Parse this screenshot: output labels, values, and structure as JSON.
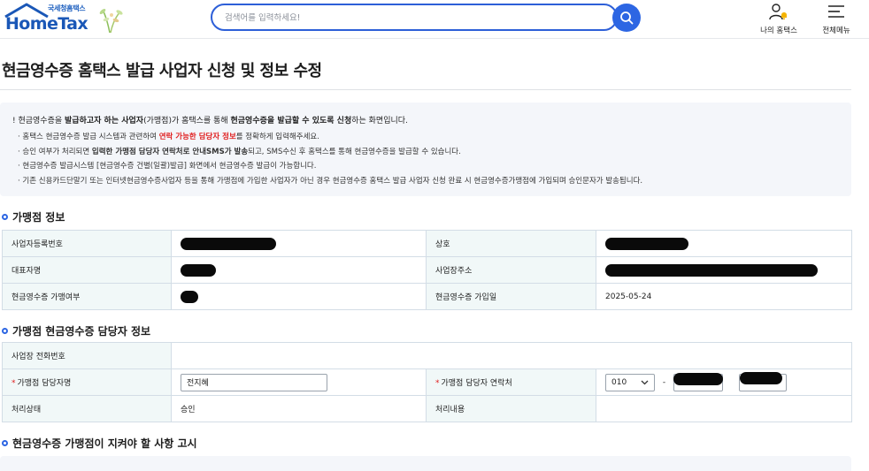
{
  "header": {
    "logo_sub": "국세청홈택스",
    "logo_main": "HomeTax",
    "search_placeholder": "검색어를 입력하세요!",
    "my_hometax": "나의 홈택스",
    "all_menu": "전체메뉴"
  },
  "page": {
    "title": "현금영수증 홈택스 발급 사업자 신청 및 정보 수정"
  },
  "notice": {
    "main": [
      "현금영수증을 ",
      "발급하고자 하는 사업자",
      "(가맹점)가 홈택스를 통해 ",
      "현금영수증을 발급할 수 있도록 신청",
      "하는 화면입니다."
    ],
    "items": [
      [
        "홈택스 현금영수증 발급 시스템과 관련하여 ",
        "연락 가능한 담당자 정보",
        "를 정확하게 입력해주세요."
      ],
      [
        "승인 여부가 처리되면 ",
        "입력한 가맹점 담당자 연락처로 안내SMS가 발송",
        "되고, SMS수신 후 홈택스를 통해 현금영수증을 발급할 수 있습니다."
      ],
      [
        "현금영수증 발급시스템 [현금영수증 건별(일괄)발급] 화면에서 현금영수증 발급이 가능합니다."
      ],
      [
        "기존 신용카드단말기 또는 인터넷현금영수증사업자 등을 통해 가맹점에 가입한 사업자가 아닌 경우 현금영수증 홈택스 발급 사업자 신청 완료 시 현금영수증가맹점에 가입되며 승인문자가 발송됩니다."
      ]
    ]
  },
  "merchant_info": {
    "title": "가맹점 정보",
    "labels": {
      "biz_no": "사업자등록번호",
      "trade_name": "상호",
      "ceo": "대표자명",
      "address": "사업장주소",
      "joined": "현금영수증 가맹여부",
      "join_date": "현금영수증 가입일"
    },
    "values": {
      "join_date": "2025-05-24"
    }
  },
  "contact_info": {
    "title": "가맹점 현금영수증 담당자 정보",
    "labels": {
      "phone": "사업장 전화번호",
      "manager_name": "가맹점 담당자명",
      "manager_phone": "가맹점 담당자 연락처",
      "status": "처리상태",
      "detail": "처리내용"
    },
    "values": {
      "manager_name": "전지혜",
      "phone_prefix": "010",
      "phone_dash": "-",
      "status": "승인"
    },
    "required_mark": "*"
  },
  "obligations": {
    "title": "현금영수증 가맹점이 지켜야 할 사항 고시"
  },
  "colors": {
    "accent": "#2d66e3",
    "required": "#e02020",
    "table_header_bg": "#f1f8f8"
  }
}
